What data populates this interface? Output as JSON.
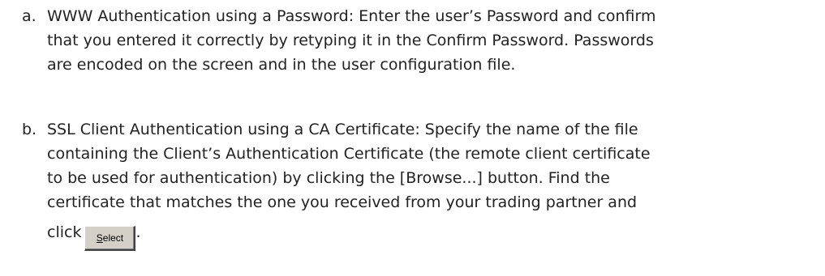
{
  "document": {
    "items": [
      {
        "marker": "a.",
        "lines": [
          "WWW Authentication using a Password: Enter the user’s Password and confirm",
          "that you entered it correctly by retyping it in the Confirm Password. Passwords",
          "are encoded on the screen and in the user configuration file."
        ]
      },
      {
        "marker": "b.",
        "lines": [
          "SSL Client Authentication using a CA Certificate: Specify the name of the file",
          "containing the Client’s Authentication Certificate (the remote client certificate",
          "to be used for authentication) by clicking the [Browse...] button.  Find the",
          "certificate that matches the one you received from your trading partner and",
          "click"
        ],
        "select_button": {
          "accel": "S",
          "rest": "elect"
        },
        "tail": "."
      }
    ]
  }
}
